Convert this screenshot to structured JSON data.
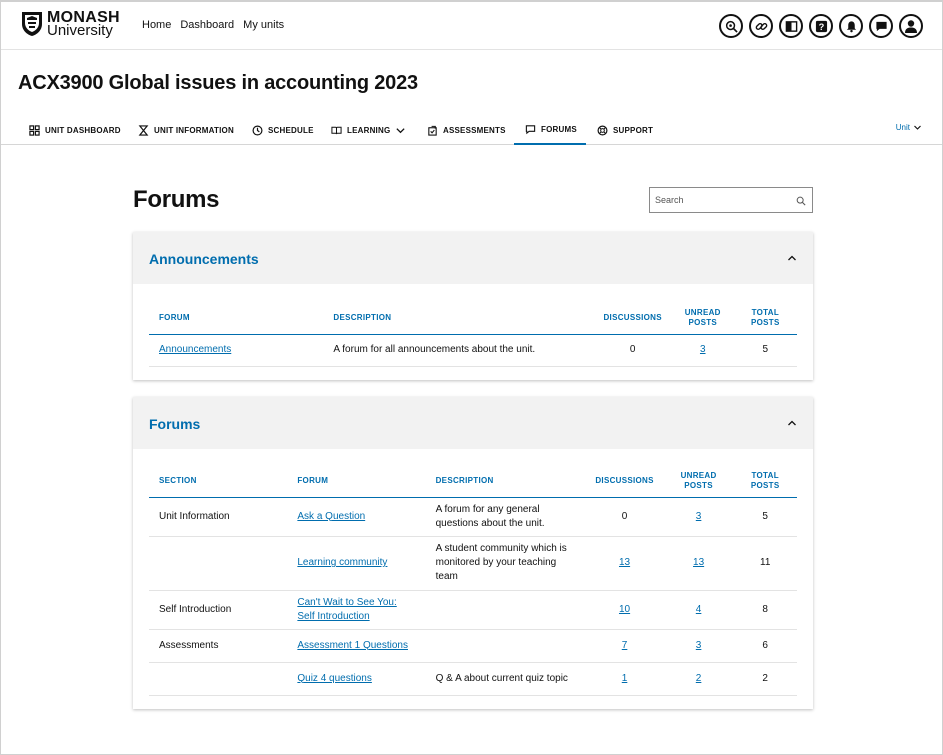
{
  "header": {
    "logo_line1": "MONASH",
    "logo_line2": "University",
    "nav": [
      "Home",
      "Dashboard",
      "My units"
    ],
    "icons": [
      "accessibility-icon",
      "link-icon",
      "book-icon",
      "help-icon",
      "bell-icon",
      "chat-icon",
      "user-avatar-icon"
    ]
  },
  "unit": {
    "title": "ACX3900 Global issues in accounting 2023",
    "tabs": [
      "UNIT DASHBOARD",
      "UNIT INFORMATION",
      "SCHEDULE",
      "LEARNING",
      "ASSESSMENTS",
      "FORUMS",
      "SUPPORT"
    ],
    "active_tab": "FORUMS",
    "unit_dropdown": "Unit"
  },
  "page": {
    "heading": "Forums",
    "search_placeholder": "Search"
  },
  "announcements": {
    "title": "Announcements",
    "columns": [
      "FORUM",
      "DESCRIPTION",
      "DISCUSSIONS",
      "UNREAD POSTS",
      "TOTAL POSTS"
    ],
    "rows": [
      {
        "forum": "Announcements",
        "description": "A forum for all announcements about the unit.",
        "discussions": "0",
        "unread": "3",
        "total": "5"
      }
    ]
  },
  "forums": {
    "title": "Forums",
    "columns": [
      "SECTION",
      "FORUM",
      "DESCRIPTION",
      "DISCUSSIONS",
      "UNREAD POSTS",
      "TOTAL POSTS"
    ],
    "rows": [
      {
        "section": "Unit Information",
        "forum": "Ask a Question",
        "description": "A forum for any general questions about the unit.",
        "discussions": "0",
        "unread": "3",
        "total": "5"
      },
      {
        "section": "",
        "forum": "Learning community",
        "description": "A student community which is monitored by your teaching team",
        "discussions": "13",
        "unread": "13",
        "total": "11"
      },
      {
        "section": "Self Introduction",
        "forum": "Can't Wait to See You: Self Introduction",
        "description": "",
        "discussions": "10",
        "unread": "4",
        "total": "8"
      },
      {
        "section": "Assessments",
        "forum": "Assessment 1 Questions",
        "description": "",
        "discussions": "7",
        "unread": "3",
        "total": "6"
      },
      {
        "section": "",
        "forum": "Quiz 4 questions",
        "description": "Q & A about current quiz topic",
        "discussions": "1",
        "unread": "2",
        "total": "2"
      }
    ]
  },
  "colors": {
    "accent": "#006dae",
    "card_header": "#f2f2f2"
  }
}
